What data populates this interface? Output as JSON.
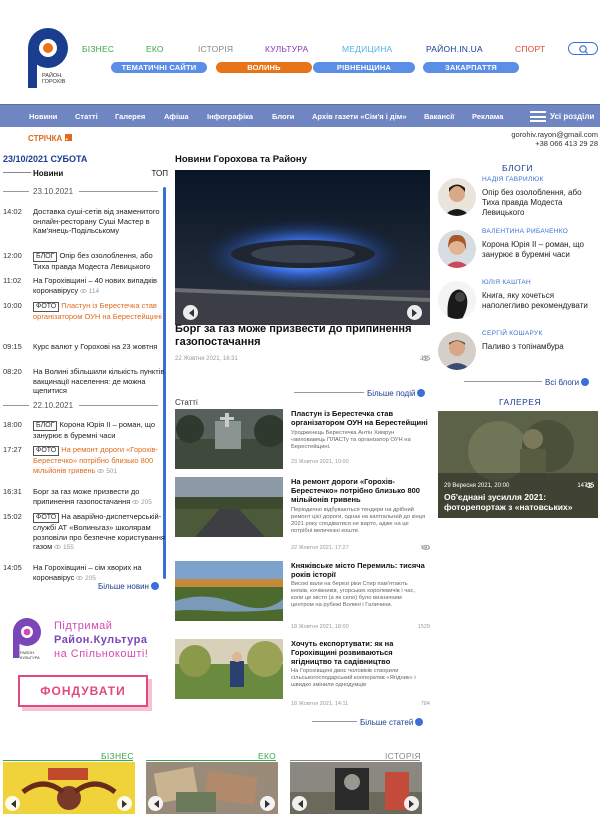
{
  "header": {
    "logo_text": [
      "РАЙОН.",
      "ГОРОХІВ"
    ],
    "topnav": [
      {
        "label": "БІЗНЕС",
        "color": "#3aa64a"
      },
      {
        "label": "ЕКО",
        "color": "#3aa64a"
      },
      {
        "label": "ІСТОРІЯ",
        "color": "#888888"
      },
      {
        "label": "КУЛЬТУРА",
        "color": "#8a3ab8"
      },
      {
        "label": "МЕДИЦИНА",
        "color": "#5ab0e0"
      },
      {
        "label": "РАЙОН.IN.UA",
        "color": "#1a3d8f"
      },
      {
        "label": "СПОРТ",
        "color": "#e24a2a"
      }
    ],
    "pills": [
      {
        "label": "ТЕМАТИЧНІ САЙТИ",
        "color": "#5b8ee6"
      },
      {
        "label": "ВОЛИНЬ",
        "color": "#e8741a"
      },
      {
        "label": "РІВНЕНЩИНА",
        "color": "#5b8ee6"
      },
      {
        "label": "ЗАКАРПАТТЯ",
        "color": "#5b8ee6"
      }
    ]
  },
  "mainnav": {
    "items": [
      "Новини",
      "Статті",
      "Галерея",
      "Афіша",
      "Інфографіка",
      "Блоги",
      "Архів газети «Сім'я і дім»",
      "Вакансії",
      "Реклама"
    ],
    "all_sections": "Усі розділи"
  },
  "stripe_label": "СТРІЧКА",
  "contact": {
    "email": "gorohiv.rayon@gmail.com",
    "phone": "+38 066 413 29 28"
  },
  "date": "23/10/2021  СУБОТА",
  "newsline": {
    "label": "Новини",
    "top_label": "ТОП",
    "days": [
      "23.10.2021",
      "22.10.2021"
    ],
    "items": [
      {
        "time": "14:02",
        "text": "Доставка суші-сетів від знаменитого онлайн-ресторану Суші Мастер в Кам'янець-Подільському",
        "tag": "",
        "views": "",
        "orange": false
      },
      {
        "time": "12:00",
        "text": "Опір без озолоблення, або Тиха правда Модеста Левицького",
        "tag": "БЛОГ",
        "views": "",
        "orange": false
      },
      {
        "time": "11:02",
        "text": "На Горохівщині – 40 нових випадків коронавірусу",
        "tag": "",
        "views": "114",
        "orange": false
      },
      {
        "time": "10:00",
        "text": "Пластун із Берестечка став організатором ОУН на Берестейщині",
        "tag": "ФОТО",
        "views": "",
        "orange": true
      },
      {
        "time": "09:15",
        "text": "Курс валют у Горохові на 23 жовтня",
        "tag": "",
        "views": "",
        "orange": false
      },
      {
        "time": "08:20",
        "text": "На Волині збільшили кількість пунктів вакцинації населення: де можна щепитися",
        "tag": "",
        "views": "",
        "orange": false
      },
      {
        "time": "18:00",
        "text": "Корона Юрія ІІ – роман, що занурює в буремні часи",
        "tag": "БЛОГ",
        "views": "",
        "orange": false
      },
      {
        "time": "17:27",
        "text": "На ремонт дороги «Горохів-Берестечко» потрібно близько 800 мільйонів гривень",
        "tag": "ФОТО",
        "views": "501",
        "orange": true
      },
      {
        "time": "16:31",
        "text": "Борг за газ може призвести до припинення газопостачання",
        "tag": "",
        "views": "205",
        "orange": false
      },
      {
        "time": "15:02",
        "text": "На аварійно-диспетчерській-службі АТ «Волиньгаз» школярам розповіли про безпечне користування газом",
        "tag": "ФОТО",
        "views": "155",
        "orange": false
      },
      {
        "time": "14:05",
        "text": "На Горохівщині – сім хворих на коронавірус",
        "tag": "",
        "views": "205",
        "orange": false
      }
    ],
    "more": "Більше новин"
  },
  "support": {
    "line1": "Підтримай",
    "line2": "Район.Культура",
    "line3": "на Спільнокошті!",
    "logo_text": "РАЙОН. КУЛЬТУРА",
    "button": "ФОНДУВАТИ"
  },
  "center": {
    "title": "Новини Горохова та Району",
    "hero": {
      "title": "Борг за газ може призвести до припинення газопостачання",
      "date": "22 Жовтня 2021, 16:31",
      "views": "255"
    },
    "more_stories": "Більше подій",
    "articles_label": "Статті",
    "articles": [
      {
        "title": "Пластун із Берестечка став організатором ОУН на Берестейщині",
        "desc": "Уродженець Берестечка Антін Химрун «виховавець ПЛАСТу та організатор ОУН на Берестейщині.",
        "date": "23 Жовтня 2021, 10:00",
        "views": ""
      },
      {
        "title": "На ремонт дороги «Горохів-Берестечко» потрібно близько 800 мільйонів гривень",
        "desc": "Періодично відбуваються тендери на дрібний ремонт цієї дороги, однак на капітальний до кінця 2021 року сподіватися не варто, адже на це потрібні величезні кошти.",
        "date": "22 Жовтня 2021, 17:27",
        "views": "501"
      },
      {
        "title": "Княжівське місто Перемиль: тисяча років історії",
        "desc": "Високі вали на березі ріки Стир пам'ятають князів, кочівників, угорських королевичів і час, коли це місто (а як село) було визначним центром на рубежі Волині і Галичини.",
        "date": "18 Жовтня 2021, 18:00",
        "views": "1529"
      },
      {
        "title": "Хочуть експортувати: як на Горохівщині розвиваються ягідництво та садівництво",
        "desc": "На Горохівщині двоє чоловіків створили сільськогосподарський кооператив «Ягідник» і швидко змінили однодумців",
        "date": "18 Жовтня 2021, 14:11",
        "views": "784"
      }
    ],
    "more_articles": "Більше статей"
  },
  "blogs": {
    "title": "БЛОГИ",
    "items": [
      {
        "author": "НАДІЯ ГАВРИЛЮК",
        "title": "Опір без озолоблення, або Тиха правда Модеста Левицького"
      },
      {
        "author": "ВАЛЕНТИНА РИБАЧЕНКО",
        "title": "Корона Юрія ІІ – роман, що занурює в буремні часи"
      },
      {
        "author": "ЮЛІЯ КАШТАН",
        "title": "Книга, яку хочеться наполегливо рекомендувати"
      },
      {
        "author": "СЕРГІЙ КОШАРУК",
        "title": "Паливо з топінамбура"
      }
    ],
    "more": "Всі блоги"
  },
  "gallery": {
    "title": "ГАЛЕРЕЯ",
    "date": "29 Вересня 2021, 20:00",
    "views": "14735",
    "caption": "Об'єднані зусилля 2021: фоторепортаж з «натовських»"
  },
  "bottom_sections": [
    {
      "label": "БІЗНЕС",
      "color": "#3aa64a"
    },
    {
      "label": "ЕКО",
      "color": "#3aa64a"
    },
    {
      "label": "ІСТОРІЯ",
      "color": "#888888"
    }
  ]
}
